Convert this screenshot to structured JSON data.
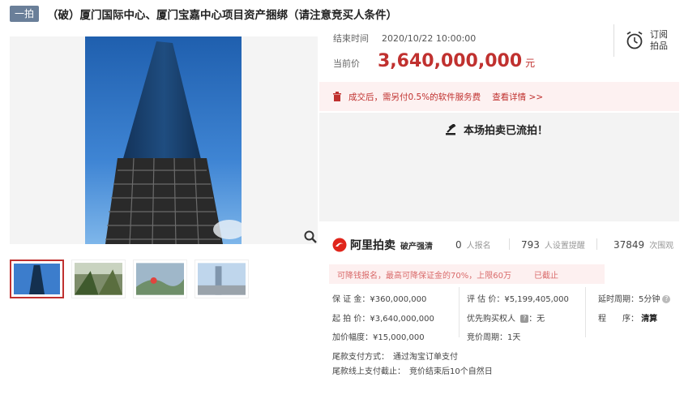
{
  "header": {
    "tag": "一拍",
    "title": "（破）厦门国际中心、厦门宝嘉中心项目资产捆绑（请注意竞买人条件）"
  },
  "auction": {
    "end_time_label": "结束时间",
    "end_time": "2020/10/22 10:00:00",
    "price_label": "当前价",
    "price": "3,640,000,000",
    "unit": "元",
    "subscribe_line1": "订阅",
    "subscribe_line2": "拍品",
    "fee_notice": "成交后，需另付0.5%的软件服务费",
    "fee_link": "查看详情 >>",
    "status": "本场拍卖已流拍！"
  },
  "brand": {
    "name": "阿里拍卖",
    "sub": "破产强清"
  },
  "stats": [
    {
      "value": "0",
      "label": "人报名"
    },
    {
      "value": "793",
      "label": "人设置提醒"
    },
    {
      "value": "37849",
      "label": "次围观"
    }
  ],
  "deposit": {
    "text": "可降钱报名，最高可降保证金的70%，上限60万",
    "status": "已截止"
  },
  "details": {
    "deposit": "保 证 金：¥360,000,000",
    "start_price": "起 拍 价：¥3,640,000,000",
    "increment": "加价幅度：¥15,000,000",
    "appraisal": "评 估 价：¥5,199,405,000",
    "priority": "优先购买权人",
    "priority_val": "：无",
    "cycle": "竞价周期：1天",
    "delay": "延时周期：5分钟",
    "procedure_label": "程　　序：",
    "procedure": "清算",
    "pay_method": "尾款支付方式：　通过淘宝订单支付",
    "pay_deadline": "尾款线上支付截止：　竞价结束后10个自然日"
  },
  "colors": {
    "accent": "#c0312f",
    "tag": "#6a7f99"
  },
  "icons": [
    "zoom-icon",
    "alarm-clock-icon",
    "trash-icon",
    "gavel-icon",
    "alibaba-logo-icon",
    "help-icon"
  ]
}
